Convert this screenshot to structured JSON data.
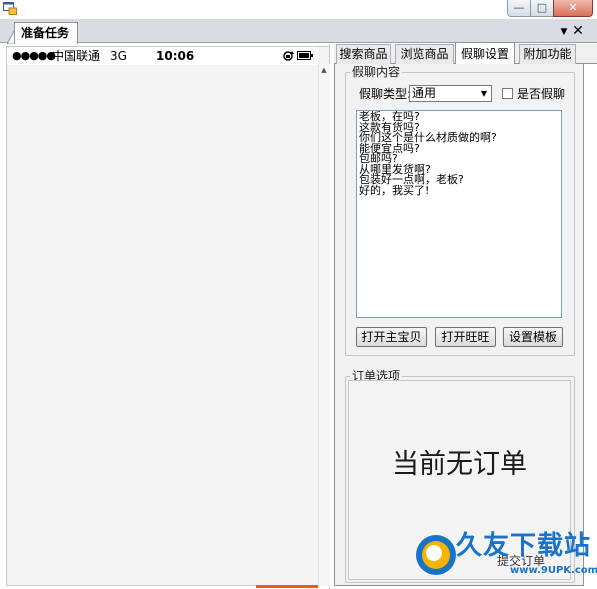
{
  "window": {
    "min_label": "—",
    "max_label": "□",
    "close_label": "✕"
  },
  "doc": {
    "tab_label": "准备任务",
    "dropdown_label": "▼",
    "close_label": "✕"
  },
  "phone": {
    "signal": "●●●●●",
    "carrier": "中国联通",
    "network": "3G",
    "time": "10:06",
    "scroll_up": "▲"
  },
  "tabs": [
    {
      "label": "搜索商品"
    },
    {
      "label": "浏览商品"
    },
    {
      "label": "假聊设置",
      "selected": true
    },
    {
      "label": "附加功能"
    }
  ],
  "chat": {
    "group_title": "假聊内容",
    "type_label": "假聊类型:",
    "type_value": "通用",
    "type_arrow": "▼",
    "checkbox_label": "是否假聊",
    "checkbox_checked": false,
    "text": "老板，在吗?\n这款有货吗?\n你们这个是什么材质做的啊?\n能便宜点吗?\n包邮吗?\n从哪里发货啊?\n包装好一点啊，老板?\n好的，我买了!",
    "btn_main": "打开主宝贝",
    "btn_wang": "打开旺旺",
    "btn_tpl": "设置模板"
  },
  "order": {
    "group_title": "订单选项",
    "empty_text": "当前无订单",
    "submit_label": "提交订单"
  },
  "watermark": {
    "brand": "久友下载站",
    "url": "www.9UPK.com"
  },
  "colors": {
    "accent_orange": "#f05a22",
    "watermark_blue": "#1a73c9",
    "close_red": "#d8705c"
  }
}
